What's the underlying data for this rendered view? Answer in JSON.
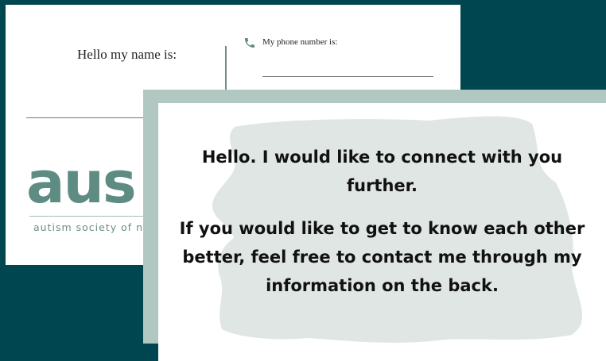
{
  "name_card": {
    "name_label": "Hello my name is:",
    "phone_label": "My phone number is:",
    "logo": {
      "letters": "aus",
      "tagline": "autism society of n"
    }
  },
  "message_card": {
    "greeting": "Hello. I would like to connect with you further.",
    "body": "If you would like to get to know each other better, feel free to contact me through my information on the back."
  },
  "colors": {
    "background": "#004650",
    "logo_green": "#5e8c82",
    "brush_gray": "#dfe6e4",
    "frame_sage": "#b1c8c2"
  }
}
